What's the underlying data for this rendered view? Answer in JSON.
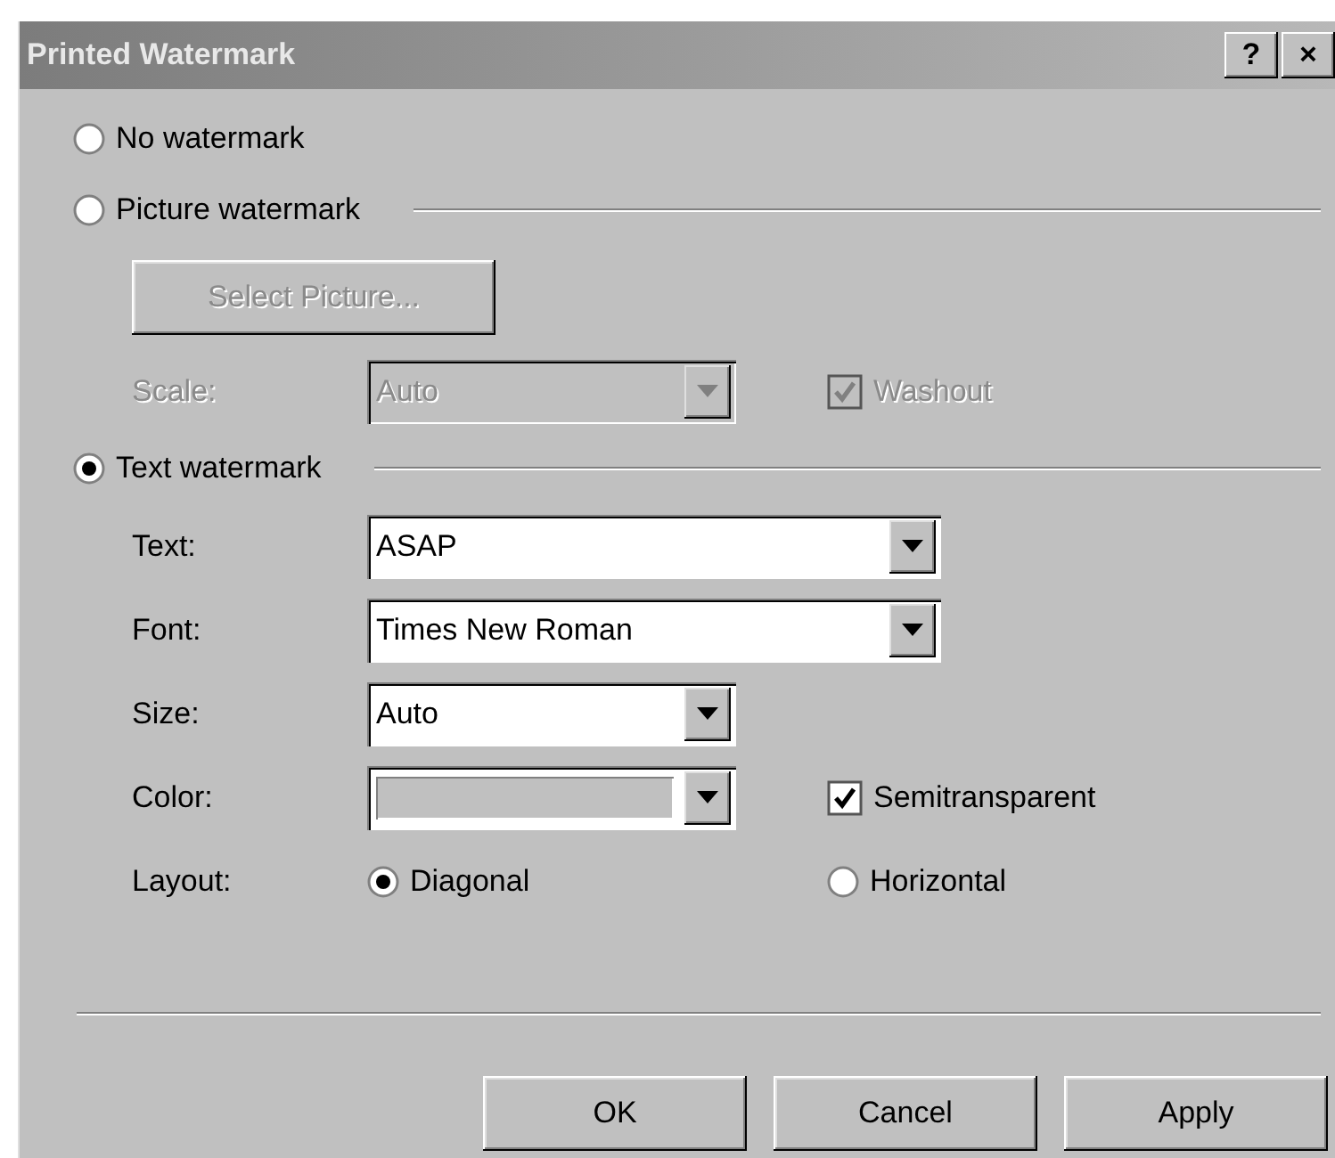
{
  "window": {
    "title": "Printed Watermark",
    "help_button": "?",
    "close_button": "×"
  },
  "no_watermark": {
    "label": "No watermark",
    "selected": false
  },
  "picture_watermark": {
    "label": "Picture watermark",
    "selected": false,
    "select_button": {
      "label": "Select Picture...",
      "disabled": true
    },
    "scale": {
      "label": "Scale:",
      "value": "Auto",
      "disabled": true
    },
    "washout": {
      "label": "Washout",
      "checked": true,
      "disabled": true
    }
  },
  "text_watermark": {
    "label": "Text watermark",
    "selected": true,
    "text": {
      "label": "Text:",
      "value": "ASAP"
    },
    "font": {
      "label": "Font:",
      "value": "Times New Roman"
    },
    "size": {
      "label": "Size:",
      "value": "Auto"
    },
    "color": {
      "label": "Color:"
    },
    "semitransparent": {
      "label": "Semitransparent",
      "checked": true,
      "disabled": false
    },
    "layout": {
      "label": "Layout:",
      "options": [
        {
          "label": "Diagonal",
          "selected": true
        },
        {
          "label": "Horizontal",
          "selected": false
        }
      ]
    }
  },
  "buttons": [
    "OK",
    "Cancel",
    "Apply"
  ]
}
